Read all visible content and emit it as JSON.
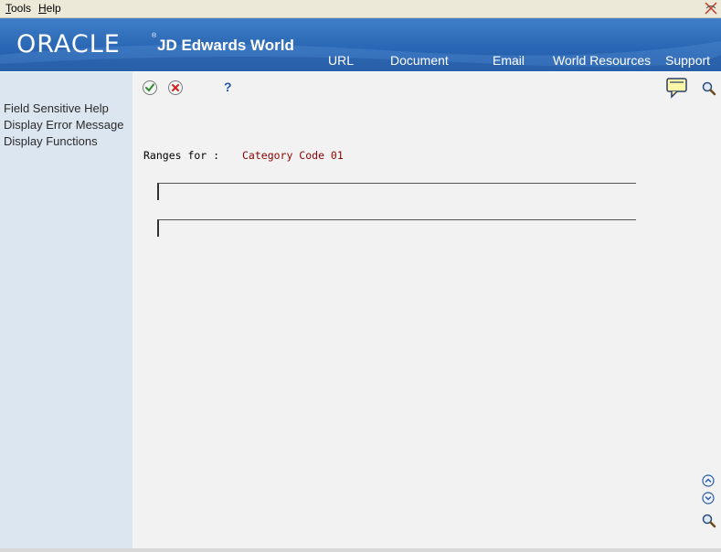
{
  "menubar": {
    "items": [
      {
        "label": "Tools",
        "accel": "T",
        "rest": "ools"
      },
      {
        "label": "Help",
        "accel": "H",
        "rest": "elp"
      }
    ]
  },
  "banner": {
    "brand": "ORACLE",
    "product": "JD Edwards World",
    "nav": [
      "URL",
      "Document",
      "Email",
      "World Resources",
      "Support"
    ]
  },
  "sidebar": {
    "items": [
      "Field Sensitive Help",
      "Display Error Message",
      "Display Functions"
    ]
  },
  "toolbar": {
    "icons": [
      "ok-check-icon",
      "cancel-x-icon",
      "help-question-icon",
      "messages-icon",
      "search-icon"
    ]
  },
  "form": {
    "ranges_label": "Ranges for :",
    "ranges_value": "Category Code 01",
    "field1_value": "",
    "field2_value": ""
  },
  "colors": {
    "banner": "#2a67b4",
    "sidebar": "#DCE6F1",
    "main": "#F2F2F2",
    "accent_text": "#8B0000"
  }
}
